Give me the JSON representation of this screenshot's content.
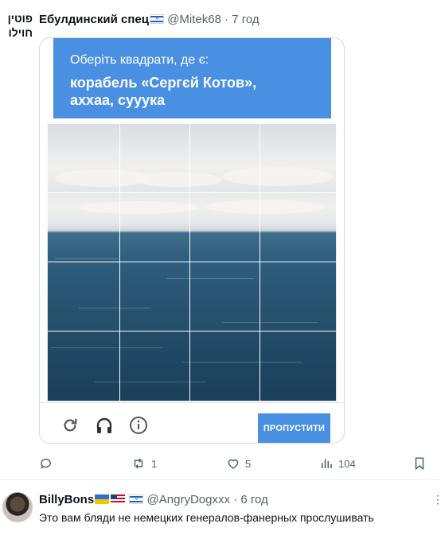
{
  "sidebar_text": "פוטין חוילו",
  "tweet": {
    "author": "Ебулдинский спец",
    "handle": "@Mitek68",
    "separator": "·",
    "time": "7 год"
  },
  "captcha": {
    "instruction": "Оберіть квадрати, де є:",
    "target_line1": "корабель «Сергєй Котов»,",
    "target_line2": "аххаа, сууука",
    "skip_label": "ПРОПУСТИТИ",
    "reload_icon": "reload-icon",
    "audio_icon": "headphones-icon",
    "info_icon": "info-icon",
    "accent_color": "#4a90e2"
  },
  "actions": {
    "replies": "",
    "retweets": "1",
    "likes": "5",
    "views": "104"
  },
  "reply": {
    "author": "BillyBons",
    "handle": "@AngryDogxxx",
    "separator": "·",
    "time": "6 год",
    "text": "Это вам бляди не немецких генералов-фанерных прослушивать"
  }
}
